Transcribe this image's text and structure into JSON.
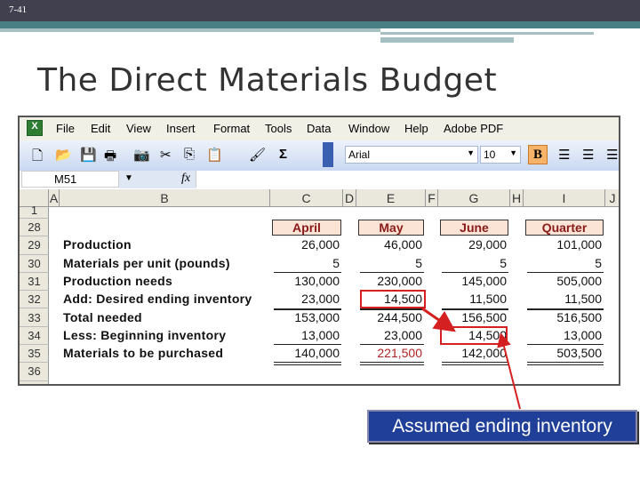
{
  "slide": {
    "number": "7-41",
    "title": "The Direct Materials Budget"
  },
  "excel": {
    "menu": [
      "File",
      "Edit",
      "View",
      "Insert",
      "Format",
      "Tools",
      "Data",
      "Window",
      "Help",
      "Adobe PDF"
    ],
    "toolbar": {
      "font": "Arial",
      "size": "10",
      "bold": "B",
      "sum": "Σ"
    },
    "name_box": "M51",
    "fx": "fx",
    "columns": [
      "A",
      "B",
      "C",
      "D",
      "E",
      "F",
      "G",
      "H",
      "I",
      "J"
    ],
    "rows": [
      "1",
      "28",
      "29",
      "30",
      "31",
      "32",
      "33",
      "34",
      "35",
      "36"
    ],
    "headers": [
      "April",
      "May",
      "June",
      "Quarter"
    ],
    "table": [
      {
        "label": "Production",
        "values": [
          "26,000",
          "46,000",
          "29,000",
          "101,000"
        ]
      },
      {
        "label": "Materials per unit (pounds)",
        "values": [
          "5",
          "5",
          "5",
          "5"
        ]
      },
      {
        "label": "Production needs",
        "values": [
          "130,000",
          "230,000",
          "145,000",
          "505,000"
        ]
      },
      {
        "label": "Add: Desired ending inventory",
        "values": [
          "23,000",
          "14,500",
          "11,500",
          "11,500"
        ]
      },
      {
        "label": "Total needed",
        "values": [
          "153,000",
          "244,500",
          "156,500",
          "516,500"
        ]
      },
      {
        "label": "Less: Beginning inventory",
        "values": [
          "13,000",
          "23,000",
          "14,500",
          "13,000"
        ]
      },
      {
        "label": "Materials to be purchased",
        "values": [
          "140,000",
          "221,500",
          "142,000",
          "503,500"
        ]
      }
    ],
    "highlight_color": "#d42020"
  },
  "callout": "Assumed ending inventory"
}
